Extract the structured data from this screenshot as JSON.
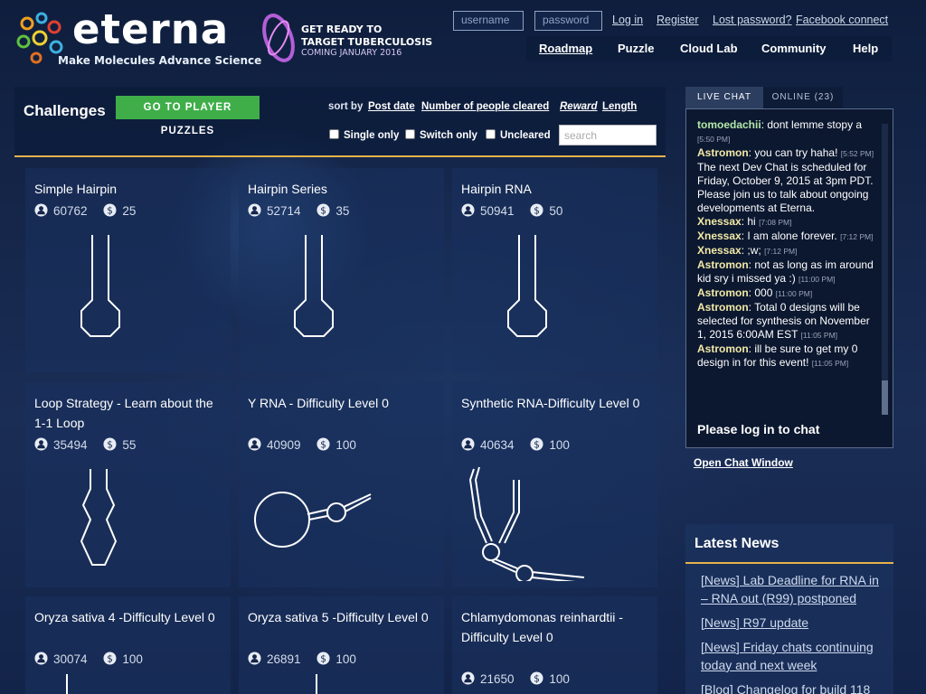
{
  "header": {
    "logo_text": "eterna",
    "tagline": "Make Molecules  Advance Science",
    "promo": {
      "line1": "GET READY TO",
      "line2": "TARGET TUBERCULOSIS",
      "line3": "COMING JANUARY 2016"
    },
    "auth": {
      "username_placeholder": "username",
      "password_placeholder": "password",
      "login": "Log in",
      "register": "Register",
      "lost_password": "Lost password?",
      "facebook": "Facebook connect"
    },
    "nav": [
      "Roadmap",
      "Puzzle",
      "Cloud Lab",
      "Community",
      "Help"
    ]
  },
  "challenges": {
    "title": "Challenges",
    "player_puzzles_button": "GO TO PLAYER PUZZLES",
    "sort_label": "sort by",
    "sort_options": [
      "Post date",
      "Number of people cleared",
      "Reward",
      "Length"
    ],
    "filters": [
      "Single only",
      "Switch only",
      "Uncleared"
    ],
    "search_placeholder": "search"
  },
  "puzzles": [
    {
      "title": "Simple Hairpin",
      "cleared": "60762",
      "reward": "25"
    },
    {
      "title": "Hairpin Series",
      "cleared": "52714",
      "reward": "35"
    },
    {
      "title": "Hairpin RNA",
      "cleared": "50941",
      "reward": "50"
    },
    {
      "title": "Loop Strategy - Learn about the 1-1 Loop",
      "cleared": "35494",
      "reward": "55"
    },
    {
      "title": "Y RNA - Difficulty Level 0",
      "cleared": "40909",
      "reward": "100"
    },
    {
      "title": "Synthetic RNA-Difficulty Level 0",
      "cleared": "40634",
      "reward": "100"
    },
    {
      "title": "Oryza sativa 4 -Difficulty Level 0",
      "cleared": "30074",
      "reward": "100"
    },
    {
      "title": "Oryza sativa 5 -Difficulty Level 0",
      "cleared": "26891",
      "reward": "100"
    },
    {
      "title": "Chlamydomonas reinhardtii - Difficulty Level 0",
      "cleared": "21650",
      "reward": "100"
    }
  ],
  "chat": {
    "tab_live": "LIVE CHAT",
    "tab_online": "ONLINE (23)",
    "messages": [
      {
        "user": "tomoedachii",
        "text": ": dont lemme stopy a",
        "time": "[5:50 PM]"
      },
      {
        "user": "Astromon",
        "text": ": you can try haha!",
        "time": "[5:52 PM]"
      },
      {
        "user": "",
        "text": "The next Dev Chat is scheduled for Friday, October 9, 2015 at 3pm PDT. Please join us to talk about ongoing developments at Eterna.",
        "time": ""
      },
      {
        "user": "Xnessax",
        "text": ": hi",
        "time": "[7:08 PM]"
      },
      {
        "user": "Xnessax",
        "text": ": I am alone forever.",
        "time": "[7:12 PM]"
      },
      {
        "user": "Xnessax",
        "text": ": ;w;",
        "time": "[7:12 PM]"
      },
      {
        "user": "Astromon",
        "text": ": not as long as im around kid sry i missed ya :)",
        "time": "[11:00 PM]"
      },
      {
        "user": "Astromon",
        "text": ": 000",
        "time": "[11:00 PM]"
      },
      {
        "user": "Astromon",
        "text": ": Total 0 designs will be selected for synthesis on November 1, 2015 6:00AM EST",
        "time": "[11:05 PM]"
      },
      {
        "user": "Astromon",
        "text": ": ill be sure to get my 0 design in for this event!",
        "time": "[11:05 PM]"
      }
    ],
    "login_prompt": "Please log in to chat",
    "open_window": "Open Chat Window"
  },
  "news": {
    "title": "Latest News",
    "items": [
      "[News] Lab Deadline for RNA in – RNA out (R99) postponed",
      "[News] R97 update",
      "[News] Friday chats continuing today and next week",
      "[Blog] Changelog for build 118"
    ]
  }
}
